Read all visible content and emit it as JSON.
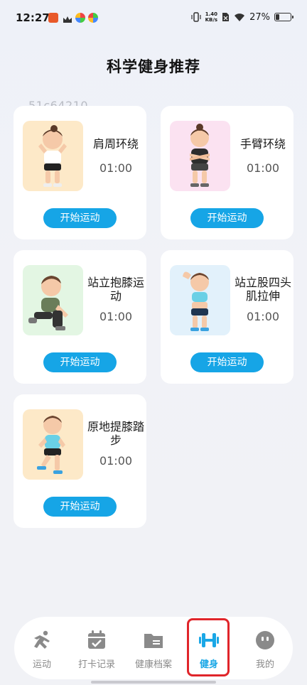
{
  "status_bar": {
    "time": "12:27",
    "net_speed_value": "1.40",
    "net_speed_unit": "KB/s",
    "battery_percent": "27%",
    "battery_level": 0.27
  },
  "page": {
    "title": "科学健身推荐",
    "watermark": "51c64210"
  },
  "exercises": [
    {
      "name": "肩周环绕",
      "duration": "01:00",
      "button": "开始运动",
      "thumb_color": "#fde9c8"
    },
    {
      "name": "手臂环绕",
      "duration": "01:00",
      "button": "开始运动",
      "thumb_color": "#fbe2f1"
    },
    {
      "name": "站立抱膝运动",
      "duration": "01:00",
      "button": "开始运动",
      "thumb_color": "#e3f6e3"
    },
    {
      "name": "站立股四头肌拉伸",
      "duration": "01:00",
      "button": "开始运动",
      "thumb_color": "#e2f1fb"
    },
    {
      "name": "原地提膝踏步",
      "duration": "01:00",
      "button": "开始运动",
      "thumb_color": "#fde9c8"
    }
  ],
  "tabbar": {
    "tabs": [
      {
        "label": "运动",
        "icon": "run-icon"
      },
      {
        "label": "打卡记录",
        "icon": "calendar-check-icon"
      },
      {
        "label": "健康档案",
        "icon": "folder-icon"
      },
      {
        "label": "健身",
        "icon": "dumbbell-icon",
        "active": true
      },
      {
        "label": "我的",
        "icon": "smiley-icon"
      }
    ],
    "active_color": "#1aa7e6",
    "inactive_color": "#8a8a8a"
  }
}
